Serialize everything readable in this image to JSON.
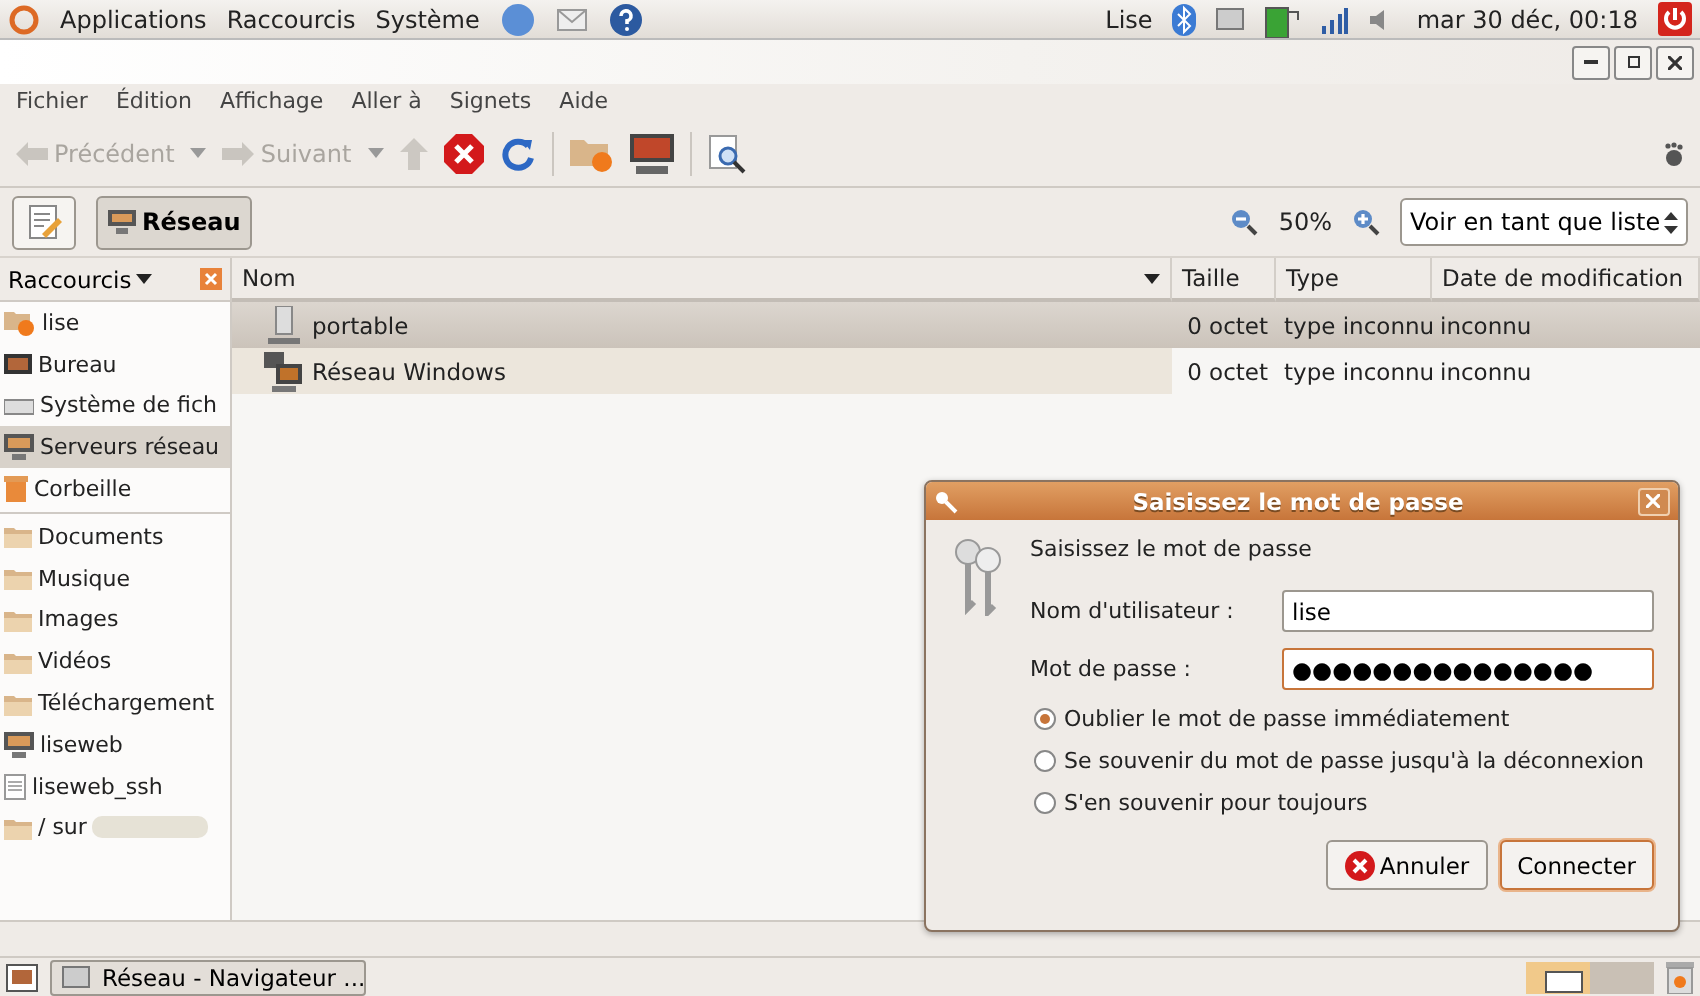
{
  "top_panel": {
    "menus": [
      "Applications",
      "Raccourcis",
      "Système"
    ],
    "user": "Lise",
    "clock": "mar 30 déc, 00:18"
  },
  "menubar": {
    "items": [
      "Fichier",
      "Édition",
      "Affichage",
      "Aller à",
      "Signets",
      "Aide"
    ]
  },
  "toolbar": {
    "buttons": [
      {
        "label": "Précédent",
        "disabled": true
      },
      {
        "label": "Suivant",
        "disabled": true
      }
    ]
  },
  "location": {
    "button": "Réseau",
    "zoom": "50%",
    "view": "Voir en tant que liste"
  },
  "sidebar": {
    "header": "Raccourcis",
    "places": [
      {
        "label": "lise",
        "kind": "home",
        "selected": false
      },
      {
        "label": "Bureau",
        "kind": "desktop",
        "selected": false
      },
      {
        "label": "Système de fich",
        "kind": "drive",
        "selected": false
      },
      {
        "label": "Serveurs réseau",
        "kind": "network",
        "selected": true
      },
      {
        "label": "Corbeille",
        "kind": "trash",
        "selected": false
      }
    ],
    "bookmarks": [
      {
        "label": "Documents",
        "kind": "folder",
        "selected": false
      },
      {
        "label": "Musique",
        "kind": "folder",
        "selected": false
      },
      {
        "label": "Images",
        "kind": "folder",
        "selected": false
      },
      {
        "label": "Vidéos",
        "kind": "folder",
        "selected": false
      },
      {
        "label": "Téléchargement",
        "kind": "folder",
        "selected": false
      },
      {
        "label": "liseweb",
        "kind": "network",
        "selected": false
      },
      {
        "label": "liseweb_ssh",
        "kind": "file",
        "selected": false
      },
      {
        "label": "/ sur",
        "kind": "folder",
        "selected": false
      }
    ]
  },
  "table": {
    "columns": [
      "Nom",
      "Taille",
      "Type",
      "Date de modification"
    ],
    "rows": [
      {
        "name": "portable",
        "size": "0 octet",
        "type": "type inconnu",
        "date": "inconnu",
        "selected": true
      },
      {
        "name": "Réseau Windows",
        "size": "0 octet",
        "type": "type inconnu",
        "date": "inconnu",
        "selected": false
      }
    ]
  },
  "dialog": {
    "title": "Saisissez le mot de passe",
    "heading": "Saisissez le mot de passe",
    "fields": [
      {
        "label": "Nom d'utilisateur :",
        "value": "lise",
        "focused": false
      },
      {
        "label": "Mot de passe :",
        "value": "●●●●●●●●●●●●●●●",
        "focused": true
      }
    ],
    "options": [
      {
        "label": "Oublier le mot de passe immédiatement",
        "selected": true
      },
      {
        "label": "Se souvenir du mot de passe jusqu'à la déconnexion",
        "selected": false
      },
      {
        "label": "S'en souvenir pour toujours",
        "selected": false
      }
    ],
    "buttons": [
      {
        "label": "Annuler",
        "kind": "cancel"
      },
      {
        "label": "Connecter",
        "kind": "default"
      }
    ]
  },
  "taskbar": {
    "tasks": [
      "Réseau - Navigateur ..."
    ]
  }
}
